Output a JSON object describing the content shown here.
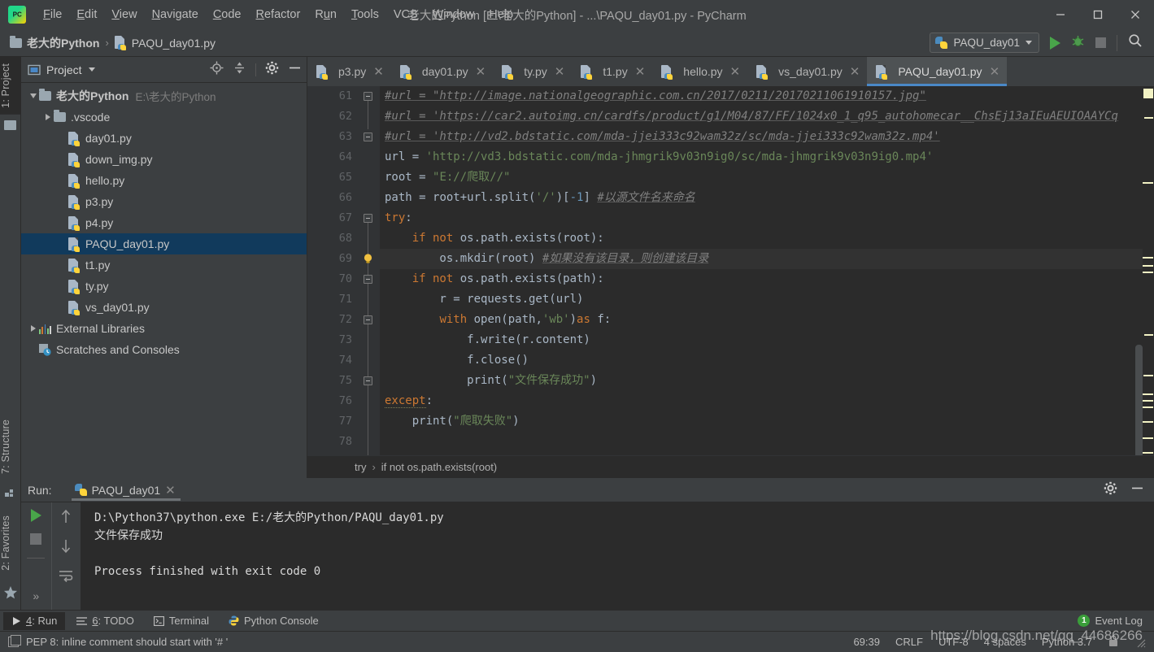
{
  "window": {
    "title": "老大的Python [E:\\老大的Python] - ...\\PAQU_day01.py - PyCharm",
    "logo_text": "PC",
    "minimize_icon": "minimize-icon",
    "maximize_icon": "maximize-icon",
    "close_icon": "close-icon"
  },
  "menu": [
    {
      "label": "File",
      "mnemonic": "F"
    },
    {
      "label": "Edit",
      "mnemonic": "E"
    },
    {
      "label": "View",
      "mnemonic": "V"
    },
    {
      "label": "Navigate",
      "mnemonic": "N"
    },
    {
      "label": "Code",
      "mnemonic": "C"
    },
    {
      "label": "Refactor",
      "mnemonic": "R"
    },
    {
      "label": "Run",
      "mnemonic": "u"
    },
    {
      "label": "Tools",
      "mnemonic": "T"
    },
    {
      "label": "VCS",
      "mnemonic": "S"
    },
    {
      "label": "Window",
      "mnemonic": "W"
    },
    {
      "label": "Help",
      "mnemonic": "H"
    }
  ],
  "navbar": {
    "crumbs": [
      {
        "label": "老大的Python",
        "icon": "folder-icon"
      },
      {
        "label": "PAQU_day01.py",
        "icon": "python-file-icon"
      }
    ],
    "separator": "›",
    "run_config": "PAQU_day01",
    "run_icon": "run-icon",
    "debug_icon": "debug-icon",
    "stop_icon": "stop-icon",
    "search_icon": "search-everywhere-icon"
  },
  "left_strip": {
    "project_tab": "1: Project",
    "structure_tab": "7: Structure",
    "favorites_tab": "2: Favorites"
  },
  "project": {
    "title": "Project",
    "tree": [
      {
        "label": "老大的Python",
        "path": "E:\\老大的Python",
        "icon": "folder-icon",
        "expanded": true,
        "depth": 0,
        "selected": false
      },
      {
        "label": ".vscode",
        "path": "",
        "icon": "folder-icon",
        "expanded": false,
        "depth": 1,
        "selected": false
      },
      {
        "label": "day01.py",
        "path": "",
        "icon": "python-file-icon",
        "depth": 2,
        "selected": false
      },
      {
        "label": "down_img.py",
        "path": "",
        "icon": "python-file-icon",
        "depth": 2,
        "selected": false
      },
      {
        "label": "hello.py",
        "path": "",
        "icon": "python-file-icon",
        "depth": 2,
        "selected": false
      },
      {
        "label": "p3.py",
        "path": "",
        "icon": "python-file-icon",
        "depth": 2,
        "selected": false
      },
      {
        "label": "p4.py",
        "path": "",
        "icon": "python-file-icon",
        "depth": 2,
        "selected": false
      },
      {
        "label": "PAQU_day01.py",
        "path": "",
        "icon": "python-file-icon",
        "depth": 2,
        "selected": true
      },
      {
        "label": "t1.py",
        "path": "",
        "icon": "python-file-icon",
        "depth": 2,
        "selected": false
      },
      {
        "label": "ty.py",
        "path": "",
        "icon": "python-file-icon",
        "depth": 2,
        "selected": false
      },
      {
        "label": "vs_day01.py",
        "path": "",
        "icon": "python-file-icon",
        "depth": 2,
        "selected": false
      },
      {
        "label": "External Libraries",
        "path": "",
        "icon": "library-icon",
        "expanded": false,
        "depth": 0,
        "selected": false
      },
      {
        "label": "Scratches and Consoles",
        "path": "",
        "icon": "scratches-icon",
        "depth": 0,
        "selected": false
      }
    ]
  },
  "editor": {
    "tabs": [
      {
        "label": "p3.py",
        "active": false
      },
      {
        "label": "day01.py",
        "active": false
      },
      {
        "label": "ty.py",
        "active": false
      },
      {
        "label": "t1.py",
        "active": false
      },
      {
        "label": "hello.py",
        "active": false
      },
      {
        "label": "vs_day01.py",
        "active": false
      },
      {
        "label": "PAQU_day01.py",
        "active": true
      }
    ],
    "first_line": 61,
    "lines": [
      {
        "n": 61,
        "tokens": [
          {
            "t": "#url = \"http://image.nationalgeographic.com.cn/2017/0211/20170211061910157.jpg\"",
            "c": "cm"
          }
        ]
      },
      {
        "n": 62,
        "tokens": [
          {
            "t": "#url = 'https://car2.autoimg.cn/cardfs/product/g1/M04/87/FF/1024x0_1_q95_autohomecar__ChsEj13aIEuAEUIOAAYCq",
            "c": "cm"
          }
        ]
      },
      {
        "n": 63,
        "tokens": [
          {
            "t": "#url = 'http://vd2.bdstatic.com/mda-jjei333c92wam32z/sc/mda-jjei333c92wam32z.mp4'",
            "c": "cm"
          }
        ]
      },
      {
        "n": 64,
        "tokens": [
          {
            "t": "url ",
            "c": "plain"
          },
          {
            "t": "= ",
            "c": "plain"
          },
          {
            "t": "'http://vd3.bdstatic.com/mda-jhmgrik9v03n9ig0/sc/mda-jhmgrik9v03n9ig0.mp4'",
            "c": "str"
          }
        ]
      },
      {
        "n": 65,
        "tokens": [
          {
            "t": "root ",
            "c": "plain"
          },
          {
            "t": "= ",
            "c": "plain"
          },
          {
            "t": "\"E://爬取//\"",
            "c": "str"
          }
        ]
      },
      {
        "n": 66,
        "tokens": [
          {
            "t": "path ",
            "c": "plain"
          },
          {
            "t": "= ",
            "c": "plain"
          },
          {
            "t": "root+url.split(",
            "c": "plain"
          },
          {
            "t": "'/'",
            "c": "str"
          },
          {
            "t": ")[",
            "c": "plain"
          },
          {
            "t": "-1",
            "c": "num"
          },
          {
            "t": "] ",
            "c": "plain"
          },
          {
            "t": "#以源文件名来命名",
            "c": "cm"
          }
        ]
      },
      {
        "n": 67,
        "tokens": [
          {
            "t": "try",
            "c": "kw"
          },
          {
            "t": ":",
            "c": "plain"
          }
        ]
      },
      {
        "n": 68,
        "tokens": [
          {
            "t": "    ",
            "c": "plain"
          },
          {
            "t": "if not ",
            "c": "kw"
          },
          {
            "t": "os.path.exists(root):",
            "c": "plain"
          }
        ]
      },
      {
        "n": 69,
        "tokens": [
          {
            "t": "        os.mkdir(root) ",
            "c": "plain"
          },
          {
            "t": "#如果没有该目录，则创建该目录",
            "c": "cm"
          }
        ],
        "highlight": true
      },
      {
        "n": 70,
        "tokens": [
          {
            "t": "    ",
            "c": "plain"
          },
          {
            "t": "if not ",
            "c": "kw"
          },
          {
            "t": "os.path.exists(path):",
            "c": "plain"
          }
        ]
      },
      {
        "n": 71,
        "tokens": [
          {
            "t": "        r = requests.get(url)",
            "c": "plain"
          }
        ]
      },
      {
        "n": 72,
        "tokens": [
          {
            "t": "        ",
            "c": "plain"
          },
          {
            "t": "with ",
            "c": "kw"
          },
          {
            "t": "open(path,",
            "c": "plain"
          },
          {
            "t": "'wb'",
            "c": "str"
          },
          {
            "t": ")",
            "c": "plain"
          },
          {
            "t": "as ",
            "c": "kw"
          },
          {
            "t": "f:",
            "c": "plain"
          }
        ]
      },
      {
        "n": 73,
        "tokens": [
          {
            "t": "            f.write(r.content)",
            "c": "plain"
          }
        ]
      },
      {
        "n": 74,
        "tokens": [
          {
            "t": "            f.close()",
            "c": "plain"
          }
        ]
      },
      {
        "n": 75,
        "tokens": [
          {
            "t": "            print(",
            "c": "plain"
          },
          {
            "t": "\"文件保存成功\"",
            "c": "str"
          },
          {
            "t": ")",
            "c": "plain"
          }
        ]
      },
      {
        "n": 76,
        "tokens": [
          {
            "t": "except",
            "c": "kw"
          },
          {
            "t": ":",
            "c": "plain"
          }
        ]
      },
      {
        "n": 77,
        "tokens": [
          {
            "t": "    print(",
            "c": "plain"
          },
          {
            "t": "\"爬取失败\"",
            "c": "str"
          },
          {
            "t": ")",
            "c": "plain"
          }
        ]
      },
      {
        "n": 78,
        "tokens": [
          {
            "t": "",
            "c": "plain"
          }
        ]
      }
    ],
    "breadcrumb": [
      "try",
      "if not os.path.exists(root)"
    ],
    "breadcrumb_sep": "›"
  },
  "run_panel": {
    "label": "Run:",
    "tab": "PAQU_day01",
    "settings_icon": "gear-icon",
    "minimize_icon": "minimize-icon",
    "rerun_icon": "rerun-icon",
    "stop_icon": "stop-icon",
    "up_icon": "arrow-up-icon",
    "down_icon": "arrow-down-icon",
    "softwrap_icon": "soft-wrap-icon",
    "more_icon": "more-icon",
    "console": [
      "D:\\Python37\\python.exe E:/老大的Python/PAQU_day01.py",
      "文件保存成功",
      "",
      "Process finished with exit code 0"
    ]
  },
  "bottom_bar": {
    "items": [
      {
        "label": "4: Run",
        "mnemonic": "4",
        "icon": "run-icon",
        "active": true
      },
      {
        "label": "6: TODO",
        "mnemonic": "6",
        "icon": "todo-icon",
        "active": false
      },
      {
        "label": "Terminal",
        "mnemonic": "",
        "icon": "terminal-icon",
        "active": false
      },
      {
        "label": "Python Console",
        "mnemonic": "",
        "icon": "python-icon",
        "active": false
      }
    ],
    "event_log": "Event Log",
    "event_count": "1"
  },
  "status_bar": {
    "message": "PEP 8: inline comment should start with '# '",
    "caret": "69:39",
    "line_sep": "CRLF",
    "encoding": "UTF-8",
    "indent": "4 spaces",
    "interpreter": "Python 3.7",
    "lock_icon": "lock-icon",
    "inspection_icon": "inspections-icon"
  },
  "watermark": "https://blog.csdn.net/qq_44686266",
  "colors": {
    "chrome": "#3c3f41",
    "editor_bg": "#2b2b2b",
    "gutter_bg": "#313335",
    "selection": "#113a5c",
    "accent": "#4a88c7",
    "keyword": "#cc7832",
    "string": "#6a8759",
    "comment": "#808080",
    "number": "#6897bb"
  }
}
